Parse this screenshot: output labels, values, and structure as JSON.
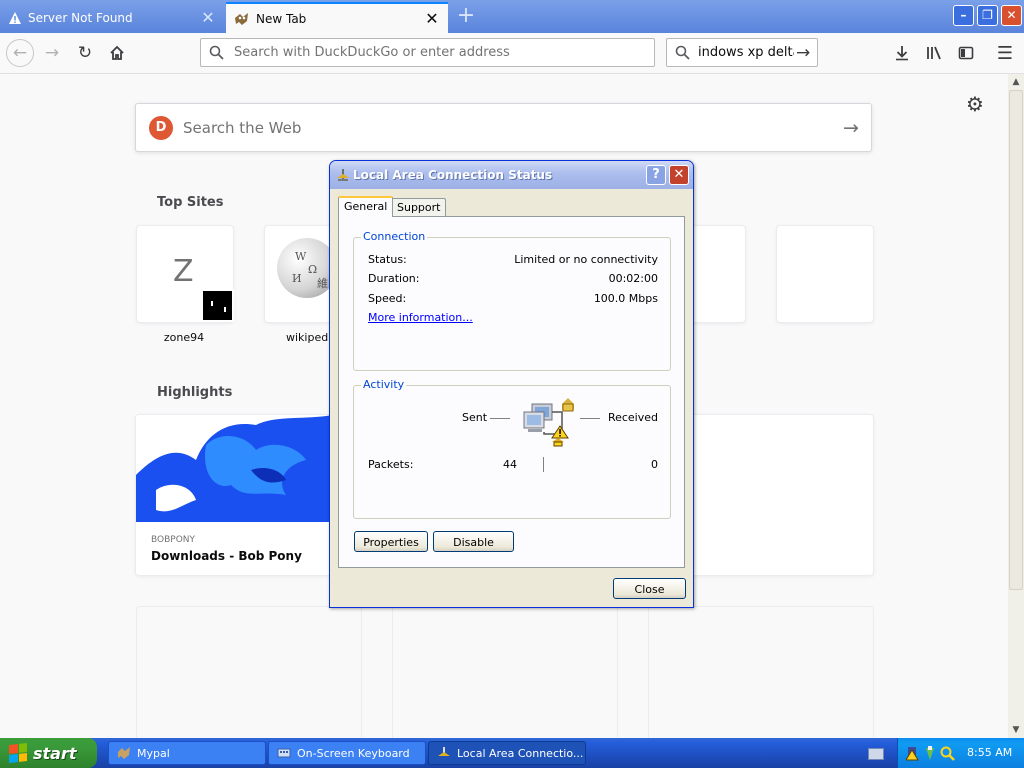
{
  "browser": {
    "tabs": [
      {
        "title": "Server Not Found",
        "active": false
      },
      {
        "title": "New Tab",
        "active": true
      }
    ],
    "urlbar": {
      "placeholder": "Search with DuckDuckGo or enter address"
    },
    "searchbar": {
      "value": "indows xp delta"
    }
  },
  "newtab": {
    "search_placeholder": "Search the Web",
    "top_sites_title": "Top Sites",
    "top_sites": [
      {
        "label": "zone94",
        "letter": "Z"
      },
      {
        "label": "wikipedia"
      }
    ],
    "highlights_title": "Highlights",
    "highlight": {
      "source": "BOBPONY",
      "title": "Downloads - Bob Pony"
    }
  },
  "dialog": {
    "title": "Local Area Connection Status",
    "tabs": {
      "general": "General",
      "support": "Support"
    },
    "connection": {
      "group_label": "Connection",
      "status_label": "Status:",
      "status_value": "Limited or no connectivity",
      "duration_label": "Duration:",
      "duration_value": "00:02:00",
      "speed_label": "Speed:",
      "speed_value": "100.0 Mbps",
      "more_info": "More information..."
    },
    "activity": {
      "group_label": "Activity",
      "sent_label": "Sent",
      "received_label": "Received",
      "packets_label": "Packets:",
      "packets_sent": "44",
      "packets_received": "0"
    },
    "buttons": {
      "properties": "Properties",
      "disable": "Disable",
      "close": "Close"
    }
  },
  "taskbar": {
    "start_label": "start",
    "tasks": [
      {
        "label": "Mypal",
        "active": false
      },
      {
        "label": "On-Screen Keyboard",
        "active": false
      },
      {
        "label": "Local Area Connectio...",
        "active": true
      }
    ],
    "clock": "8:55 AM"
  },
  "colors": {
    "xp_title_blue": "#0831d9",
    "xp_start_green": "#3a9a3a",
    "taskbar_blue": "#245edb",
    "ddg_orange": "#de5833",
    "focus_blue": "#0a84ff"
  },
  "icons": [
    "warning-icon",
    "newtab-icon",
    "close-icon",
    "plus-icon",
    "back-icon",
    "forward-icon",
    "reload-icon",
    "home-icon",
    "search-icon",
    "arrow-right-icon",
    "download-icon",
    "library-icon",
    "sidebar-icon",
    "hamburger-menu-icon",
    "gear-icon",
    "duckduckgo-icon",
    "network-connection-icon",
    "help-icon",
    "windows-flag-icon",
    "keyboard-icon"
  ]
}
